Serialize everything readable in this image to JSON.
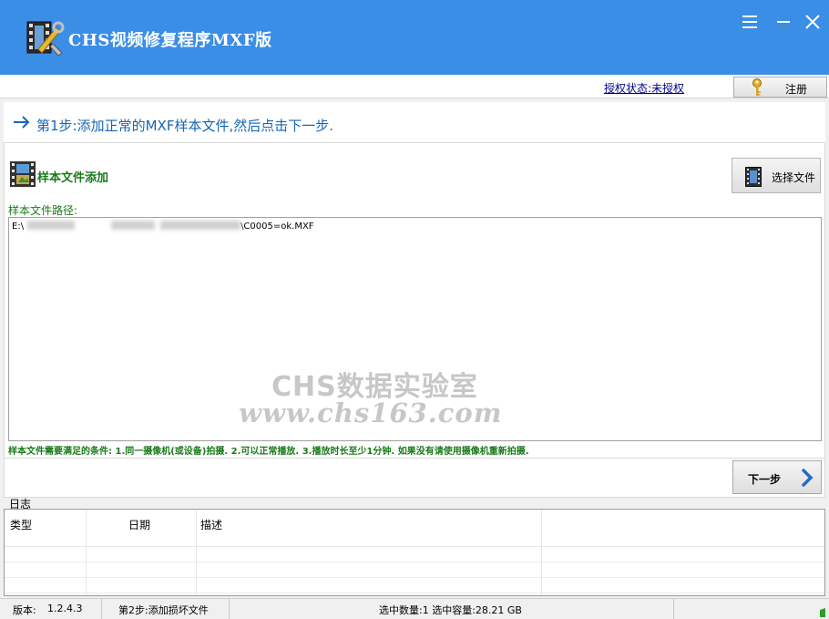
{
  "window": {
    "title": "CHS视频修复程序MXF版"
  },
  "license": {
    "status_link": "授权状态:未授权",
    "register_label": "注册"
  },
  "step": {
    "text": "第1步:添加正常的MXF样本文件,然后点击下一步."
  },
  "sample": {
    "section_title": "样本文件添加",
    "choose_label": "选择文件",
    "path_label": "样本文件路径:",
    "path_prefix": "E:\\",
    "path_suffix": "\\C0005=ok.MXF",
    "watermark_line1": "CHS数据实验室",
    "watermark_line2": "www.chs163.com",
    "conditions": "样本文件需要满足的条件: 1.同一摄像机(或设备)拍摄. 2.可以正常播放. 3.播放时长至少1分钟. 如果没有请使用摄像机重新拍摄."
  },
  "next": {
    "label": "下一步"
  },
  "log": {
    "label": "日志",
    "columns": [
      "类型",
      "日期",
      "描述"
    ]
  },
  "status": {
    "version_label": "版本:",
    "version_value": "1.2.4.3",
    "next_step": "第2步:添加损坏文件",
    "selection": "选中数量:1 选中容量:28.21 GB"
  },
  "colors": {
    "titlebar": "#3a8ee6",
    "accent_green": "#1a7a1a",
    "step_blue": "#1565b8"
  }
}
